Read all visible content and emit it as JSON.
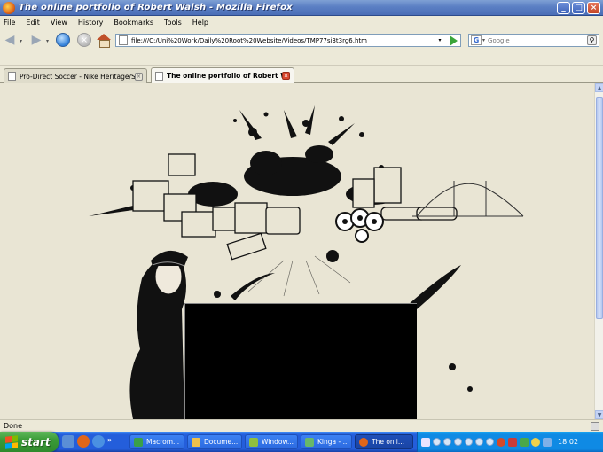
{
  "window": {
    "title": "The online portfolio of Robert Walsh - Mozilla Firefox",
    "buttons": {
      "minimize": "_",
      "maximize": "□",
      "close": "×"
    }
  },
  "menu": [
    "File",
    "Edit",
    "View",
    "History",
    "Bookmarks",
    "Tools",
    "Help"
  ],
  "navigation": {
    "url": "file:///C:/Uni%20Work/Daily%20Root%20Website/Videos/TMP77si3t3rg6.htm",
    "search_engine_letter": "G",
    "search_placeholder": "Google"
  },
  "tabs": [
    {
      "label": "Pro-Direct Soccer - Nike Heritage/Spe...",
      "active": false
    },
    {
      "label": "The online portfolio of Robert Wa...",
      "active": true
    }
  ],
  "status": {
    "text": "Done"
  },
  "taskbar": {
    "start_label": "start",
    "quick_more": "»",
    "tasks": [
      {
        "label": "Macrom...",
        "color": "#3aa04a",
        "active": false
      },
      {
        "label": "Docume...",
        "color": "#f0c14b",
        "active": false
      },
      {
        "label": "Window...",
        "color": "#8fbf3f",
        "active": false
      },
      {
        "label": "Kinga - ...",
        "color": "#68b86a",
        "active": false
      },
      {
        "label": "The onli...",
        "color": "#e0661a",
        "active": true
      }
    ],
    "clock": "18:02"
  },
  "colors": {
    "page_background": "#e9e5d4",
    "taskbar_blue": "#245edb",
    "start_green": "#3a9b37"
  }
}
